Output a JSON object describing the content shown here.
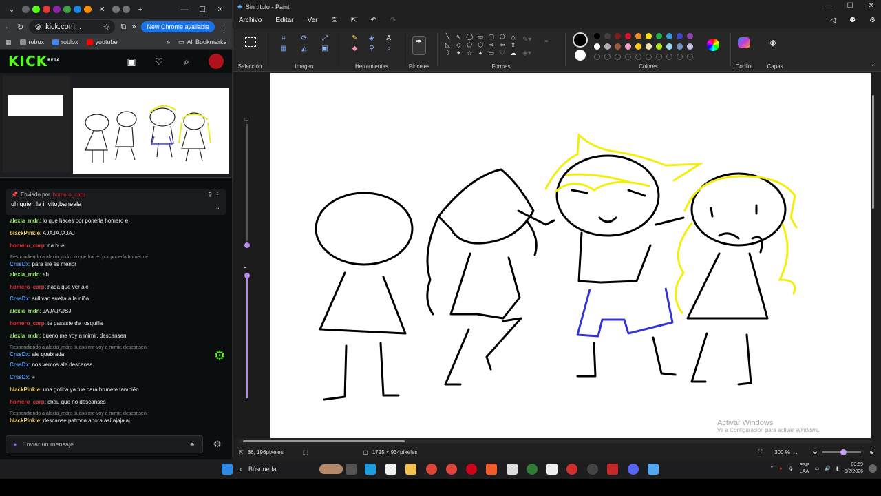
{
  "browser": {
    "address": "kick.com...",
    "update_button": "New Chrome available",
    "bookmarks": [
      {
        "label": "robux",
        "color": "#4285f4"
      },
      {
        "label": "roblox",
        "color": "#4285f4"
      },
      {
        "label": "youtube",
        "color": "#ff0000"
      }
    ],
    "all_bookmarks": "All Bookmarks"
  },
  "kick": {
    "logo": "KICK",
    "logo_badge": "BETA",
    "pinned": {
      "sent_by_label": "Enviado por",
      "sent_by_user": "homero_carp",
      "message": "uh quien la invito,baneala"
    },
    "chat": [
      {
        "user": "alexia_mdn",
        "color": "#9ae66e",
        "text": "lo que haces por ponerla homero e"
      },
      {
        "user": "blackPinkie",
        "color": "#f7d26e",
        "text": "AJAJAJAJAJ"
      },
      {
        "user": "homero_carp",
        "color": "#e0323c",
        "text": "na bue"
      },
      {
        "reply": "Respondiendo a alexia_mdn: lo que haces por ponerla homero e",
        "user": "CrssDx",
        "color": "#5a9bf0",
        "text": "para ale es menor"
      },
      {
        "user": "alexia_mdn",
        "color": "#9ae66e",
        "text": "eh"
      },
      {
        "user": "homero_carp",
        "color": "#e0323c",
        "text": "nada que ver ale"
      },
      {
        "user": "CrssDx",
        "color": "#5a9bf0",
        "text": "sullivan suelta a la niña"
      },
      {
        "user": "alexia_mdn",
        "color": "#9ae66e",
        "text": "JAJAJAJSJ"
      },
      {
        "user": "homero_carp",
        "color": "#e0323c",
        "text": "te pasaste de rosquilla"
      },
      {
        "user": "alexia_mdn",
        "color": "#9ae66e",
        "text": "bueno me voy a mimir, descansen"
      },
      {
        "reply": "Respondiendo a alexia_mdn: bueno me voy a mimir, descansen",
        "user": "CrssDx",
        "color": "#5a9bf0",
        "text": "ale quebrada"
      },
      {
        "user": "CrssDx",
        "color": "#5a9bf0",
        "text": "nos vemos ale descansa"
      },
      {
        "user": "CrssDx",
        "color": "#5a9bf0",
        "text": ""
      },
      {
        "user": "blackPinkie",
        "color": "#f7d26e",
        "text": "una gotica ya fue para brunete también"
      },
      {
        "user": "homero_carp",
        "color": "#e0323c",
        "text": "chau que no descanses"
      },
      {
        "reply": "Respondiendo a alexia_mdn: bueno me voy a mimir, descansen",
        "user": "blackPinkie",
        "color": "#f7d26e",
        "text": "descanse patrona ahora así ajajajaj"
      }
    ],
    "input_placeholder": "Enviar un mensaje"
  },
  "paint": {
    "title": "Sin título - Paint",
    "menu": [
      "Archivo",
      "Editar",
      "Ver"
    ],
    "groups": {
      "seleccion": "Selección",
      "imagen": "Imagen",
      "herramientas": "Herramientas",
      "pinceles": "Pinceles",
      "formas": "Formas",
      "colores": "Colores",
      "copilot": "Copilot",
      "capas": "Capas"
    },
    "palette_row1": [
      "#000000",
      "#404040",
      "#7f1d1d",
      "#e0102d",
      "#f08a24",
      "#fbe015",
      "#22b14c",
      "#3a9ad9",
      "#3f48cc",
      "#8e44ad"
    ],
    "palette_row2": [
      "#ffffff",
      "#b0b0b0",
      "#9c5a3c",
      "#f5a3c7",
      "#ffc90e",
      "#efe4b0",
      "#b5e61d",
      "#99d9ea",
      "#7092be",
      "#c8bfe7"
    ],
    "status": {
      "cursor": "86, 196píxeles",
      "size": "1725 × 934píxeles",
      "zoom": "300 %"
    },
    "watermark_title": "Activar Windows",
    "watermark_sub": "Ve a Configuración para activar Windows."
  },
  "taskbar": {
    "search": "Búsqueda",
    "lang": "ESP",
    "region": "LAA",
    "time": "03:59",
    "date": "5/2/2026"
  }
}
